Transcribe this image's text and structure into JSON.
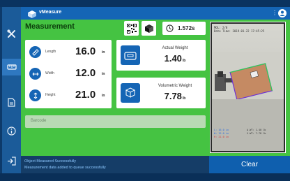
{
  "app": {
    "name": "vMeasure"
  },
  "header": {
    "menu_dots": "⋮"
  },
  "title": "Measurement",
  "timer": {
    "value": "1.572s"
  },
  "dimensions": [
    {
      "label": "Length",
      "value": "16.0",
      "unit": "in",
      "icon": "ruler-icon"
    },
    {
      "label": "Width",
      "value": "12.0",
      "unit": "in",
      "icon": "width-icon"
    },
    {
      "label": "Height",
      "value": "21.0",
      "unit": "in",
      "icon": "height-icon"
    }
  ],
  "actual_weight": {
    "label": "Actual Weight",
    "value": "1.40",
    "unit": "lb"
  },
  "volumetric_weight": {
    "label": "Volumetric Weight",
    "value": "7.78",
    "unit": "lb"
  },
  "barcode": {
    "placeholder": "Barcode"
  },
  "camera": {
    "line1": "MOL: 2/0",
    "line2": "Date Time: 2019-01-22 17:45:25",
    "readouts": [
      {
        "text": "L: 16.0 in",
        "color": "#2b6be0"
      },
      {
        "text": "W: 12.0 in",
        "color": "#2b6be0"
      },
      {
        "text": "H: 21.0 in",
        "color": "#d23c3c"
      }
    ],
    "readouts_right": [
      {
        "text": "A.WT: 1.40 lb"
      },
      {
        "text": "V.WT: 7.78 lb"
      }
    ]
  },
  "status": {
    "line1": "Object Measured Successfully",
    "line2": "Measurement data added to queue successfully"
  },
  "clear_label": "Clear",
  "colors": {
    "primary_blue": "#1565b5",
    "panel_green": "#45c342",
    "status_text": "#8ec8ff"
  }
}
